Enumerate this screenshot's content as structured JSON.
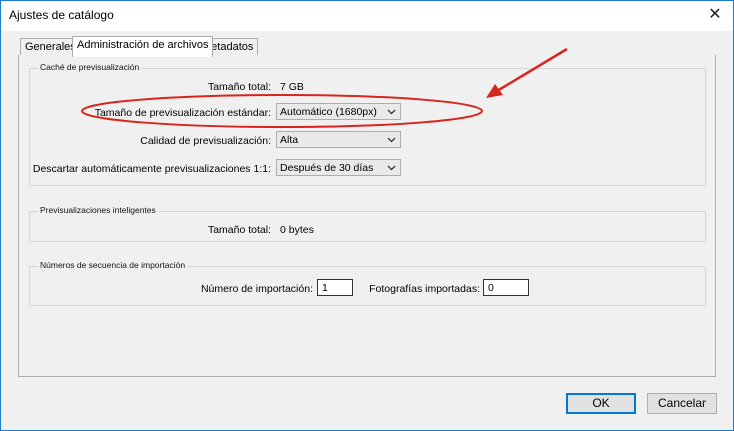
{
  "window": {
    "title": "Ajustes de catálogo",
    "close_glyph": "✕"
  },
  "tabs": [
    {
      "label": "Generales"
    },
    {
      "label": "Administración de archivos"
    },
    {
      "label": "Metadatos"
    }
  ],
  "preview_cache": {
    "legend": "Caché de previsualización",
    "total_size_label": "Tamaño total:",
    "total_size_value": "7 GB",
    "standard_size_label": "Tamaño de previsualización estándar:",
    "standard_size_value": "Automático (1680px)",
    "quality_label": "Calidad de previsualización:",
    "quality_value": "Alta",
    "discard_label": "Descartar automáticamente previsualizaciones 1:1:",
    "discard_value": "Después de 30 días"
  },
  "smart_previews": {
    "legend": "Previsualizaciones inteligentes",
    "total_size_label": "Tamaño total:",
    "total_size_value": "0 bytes"
  },
  "import_sequence": {
    "legend": "Números de secuencia de importación",
    "import_number_label": "Número de importación:",
    "import_number_value": "1",
    "photos_imported_label": "Fotografías importadas:",
    "photos_imported_value": "0"
  },
  "footer": {
    "ok_label": "OK",
    "cancel_label": "Cancelar"
  },
  "annotation": {
    "color": "#d7261e"
  }
}
